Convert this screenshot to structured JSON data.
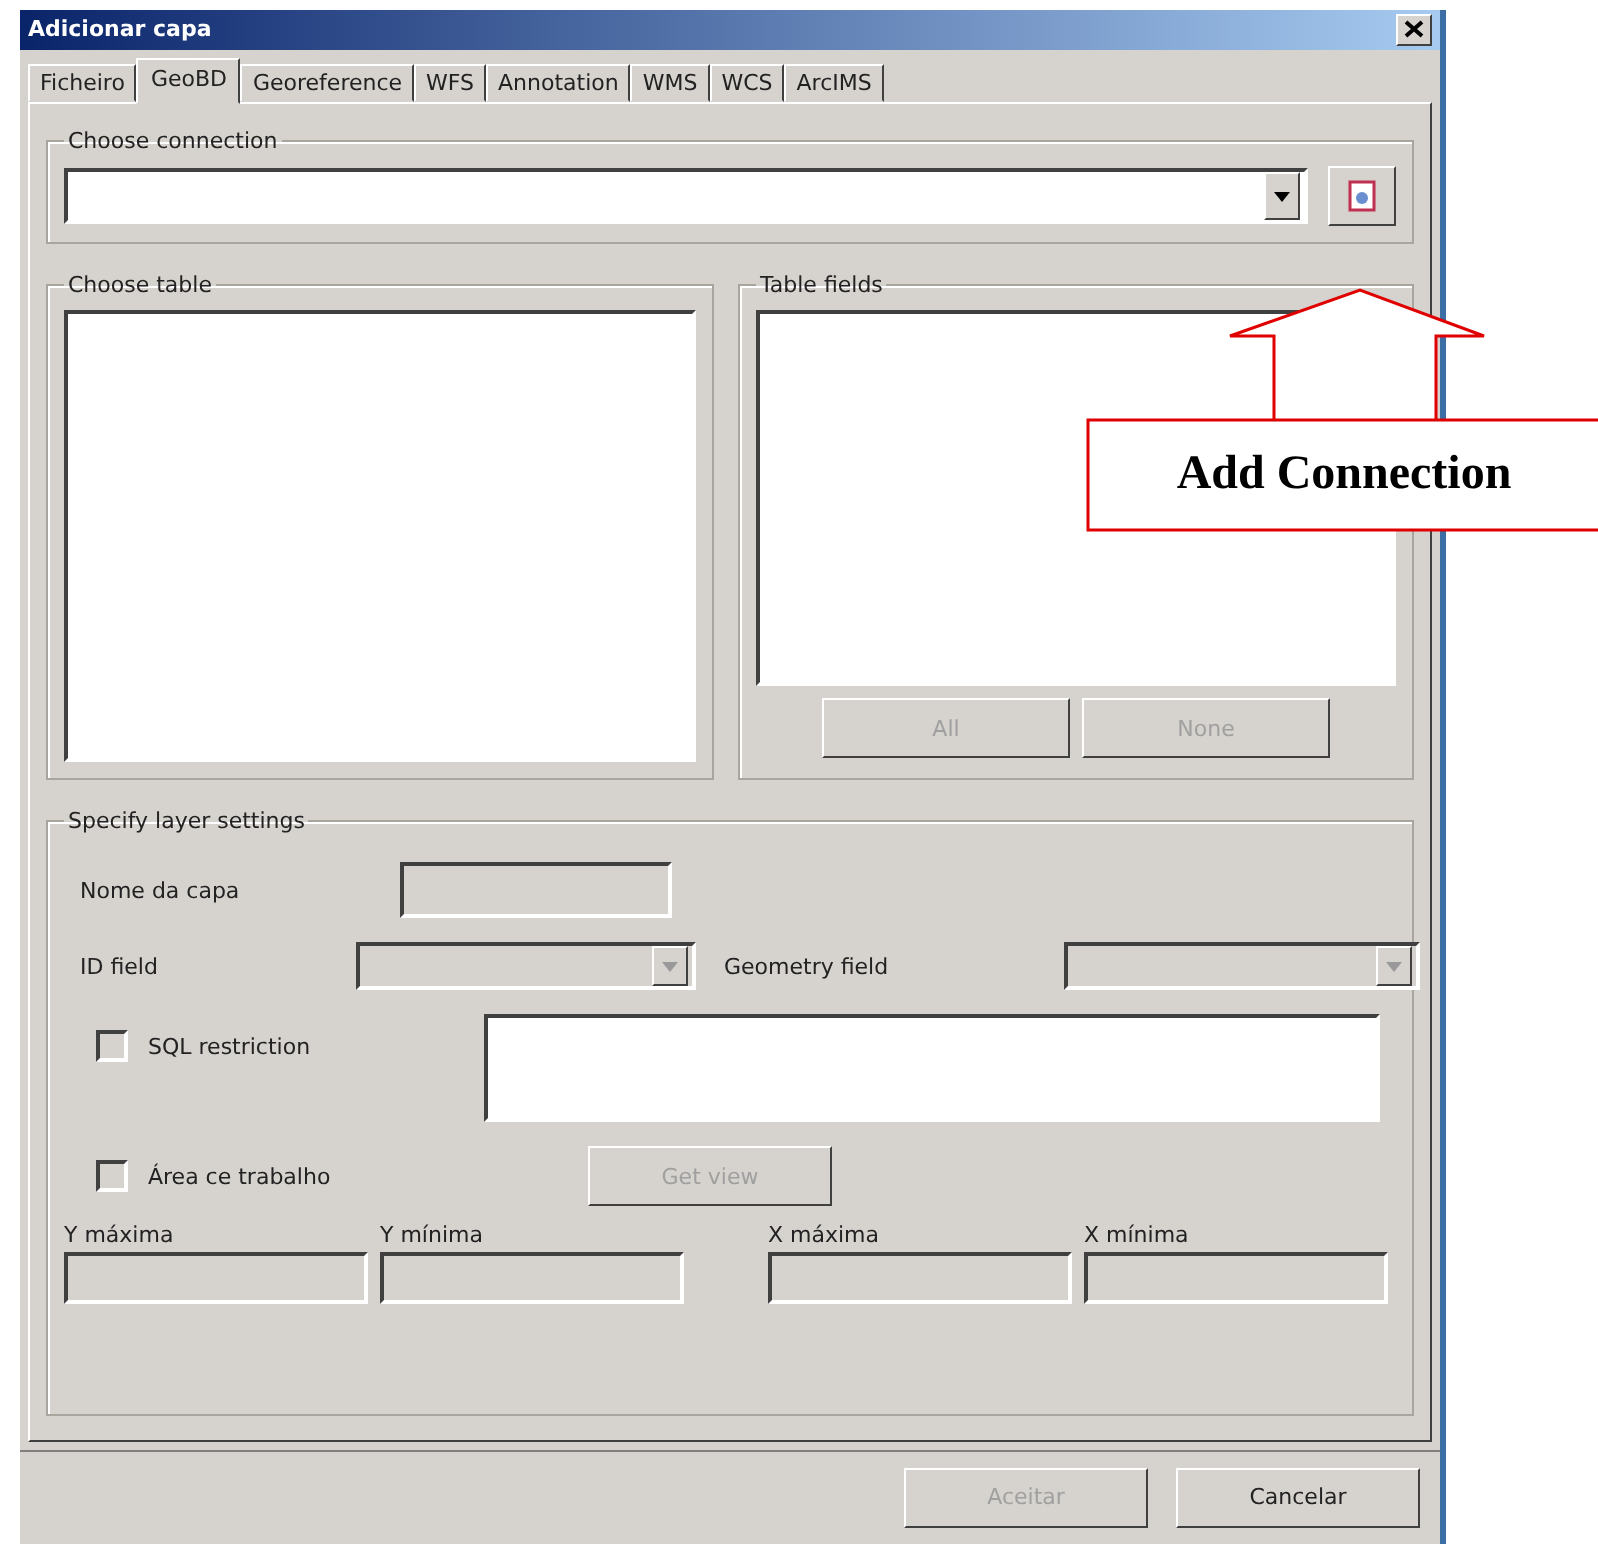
{
  "window": {
    "title": "Adicionar capa"
  },
  "tabs": [
    {
      "label": "Ficheiro",
      "selected": false
    },
    {
      "label": "GeoBD",
      "selected": true
    },
    {
      "label": "Georeference",
      "selected": false
    },
    {
      "label": "WFS",
      "selected": false
    },
    {
      "label": "Annotation",
      "selected": false
    },
    {
      "label": "WMS",
      "selected": false
    },
    {
      "label": "WCS",
      "selected": false
    },
    {
      "label": "ArcIMS",
      "selected": false
    }
  ],
  "connection": {
    "title": "Choose connection"
  },
  "table": {
    "title": "Choose table"
  },
  "fields": {
    "title": "Table fields",
    "buttons": [
      {
        "label": "All",
        "disabled": true
      },
      {
        "label": "None",
        "disabled": true
      }
    ]
  },
  "layer_settings": {
    "title": "Specify layer settings",
    "layer_name": {
      "label": "Nome da capa",
      "disabled": true
    },
    "id_field": {
      "label": "ID field",
      "disabled": true
    },
    "geometry_field": {
      "label": "Geometry field",
      "disabled": true
    },
    "sql": {
      "label": "SQL restriction",
      "checked": false
    },
    "work_area": {
      "label": "Área ce trabalho",
      "checked": false
    },
    "get_view": {
      "label": "Get view",
      "disabled": true
    },
    "extents": [
      {
        "label": "Y máxima",
        "disabled": true
      },
      {
        "label": "Y mínima",
        "disabled": true
      },
      {
        "label": "X máxima",
        "disabled": true
      },
      {
        "label": "X mínima",
        "disabled": true
      }
    ]
  },
  "buttons": [
    {
      "label": "Aceitar",
      "disabled": true
    },
    {
      "label": "Cancelar",
      "disabled": false
    }
  ],
  "callout": {
    "text": "Add Connection"
  }
}
